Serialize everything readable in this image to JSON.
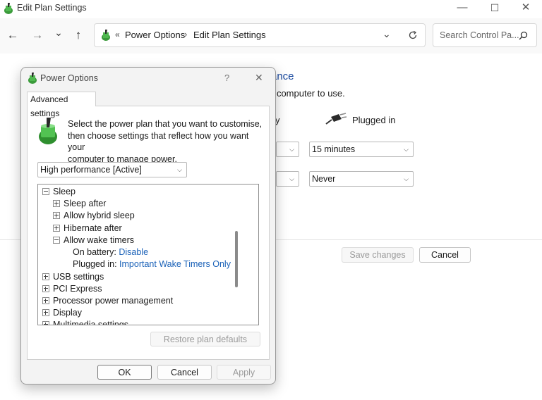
{
  "window": {
    "title": "Edit Plan Settings",
    "minimize": "—",
    "maximize": "☐",
    "close": "✕"
  },
  "nav": {
    "back": "←",
    "forward": "→",
    "recent": "⌄",
    "up": "↑",
    "breadcrumb_sep": "«",
    "crumb1": "Power Options",
    "crumb_arrow": "›",
    "crumb2": "Edit Plan Settings",
    "search_placeholder": "Search Control Pa...",
    "search_icon": "search-icon",
    "refresh_icon": "refresh-icon"
  },
  "background": {
    "heading_fragment": "ance",
    "desc_fragment": "r computer to use.",
    "on_battery_fragment": "y",
    "plugged_in": "Plugged in",
    "display_plugged": "15 minutes",
    "sleep_plugged": "Never",
    "save_changes": "Save changes",
    "cancel": "Cancel"
  },
  "dialog": {
    "title": "Power Options",
    "help": "?",
    "close": "✕",
    "tab": "Advanced settings",
    "instructions": [
      "Select the power plan that you want to customise,",
      "then choose settings that reflect how you want your",
      "computer to manage power."
    ],
    "plan": "High performance [Active]",
    "tree": {
      "sleep": "Sleep",
      "sleep_after": "Sleep after",
      "hybrid": "Allow hybrid sleep",
      "hibernate": "Hibernate after",
      "wake_timers": "Allow wake timers",
      "on_battery_label": "On battery:",
      "on_battery_value": "Disable",
      "plugged_label": "Plugged in:",
      "plugged_value": "Important Wake Timers Only",
      "usb": "USB settings",
      "pci": "PCI Express",
      "processor": "Processor power management",
      "display": "Display",
      "multimedia": "Multimedia settings"
    },
    "restore": "Restore plan defaults",
    "ok": "OK",
    "cancel": "Cancel",
    "apply": "Apply"
  },
  "colors": {
    "link": "#1b62b8",
    "heading": "#1b4aa0"
  }
}
